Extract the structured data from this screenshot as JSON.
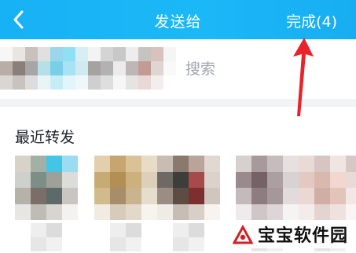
{
  "header": {
    "title": "发送给",
    "done_label": "完成(4)"
  },
  "search": {
    "placeholder": "搜索"
  },
  "recent": {
    "title": "最近转发",
    "avatars": [
      {
        "palette": [
          "#d8d3c8",
          "#a2b0a6",
          "#43c6e6",
          "#9bdcf0",
          "#cfcfcc",
          "#7b8f87",
          "#a0a09a",
          "#dcdcd9",
          "#b7b2a9",
          "#7b6e66",
          "#5d6a6a",
          "#c9c6c1",
          "#e8e6e2",
          "#bfbcb6",
          "#d8d5d0",
          "#f3f2ef"
        ]
      },
      {
        "palette": [
          "#e3cfae",
          "#c6a571",
          "#d9c296",
          "#e8dcc6",
          "#c7ab75",
          "#b38e55",
          "#cdb17c",
          "#ddd0bb",
          "#d2ba8d",
          "#a78d69",
          "#c9b48e",
          "#e6ddcd",
          "#f0ece4",
          "#d7ccbb",
          "#e2d9ca",
          "#f7f4ef"
        ]
      },
      {
        "palette": [
          "#c8bdb2",
          "#8a7a6e",
          "#b9a39a",
          "#e1d8d1",
          "#6e6a63",
          "#3d3d3a",
          "#a64b4a",
          "#dcd2cc",
          "#9a8e84",
          "#5b4c44",
          "#7d2f2f",
          "#cfc6bf",
          "#efebe7",
          "#c7bdb5",
          "#d8cfc8",
          "#f6f3f0"
        ]
      },
      {
        "palette": [
          "#d6d0cf",
          "#a8999b",
          "#c5bcbd",
          "#e6e1e0",
          "#9a8a8d",
          "#756267",
          "#ab9fa2",
          "#d9d2d2",
          "#c4b9bb",
          "#8d7c80",
          "#a5979a",
          "#e2dbdc",
          "#efebec",
          "#cfc6c8",
          "#ddd5d7",
          "#f6f3f3"
        ]
      },
      {
        "palette": [
          "#e8dad6",
          "#d8c5c3",
          "#f0e5e3",
          "#d7c7c5",
          "#e4c9c2",
          "#d9b8ae",
          "#f1d7cf",
          "#e9dad7",
          "#ead8d2",
          "#cfaea5",
          "#e2c4bb",
          "#f2e7e4",
          "#f4ecea",
          "#e3d4d0",
          "#efe2de",
          "#f9f5f4"
        ]
      }
    ]
  },
  "watermark": {
    "text": "宝宝软件园"
  },
  "colors": {
    "header_bg": "#1bb8f7",
    "arrow": "#e8232a",
    "section_bg": "#f2f3f5"
  },
  "icons": {
    "back": "chevron-left-icon",
    "search": "search-icon",
    "logo": "baobao-logo-icon"
  }
}
